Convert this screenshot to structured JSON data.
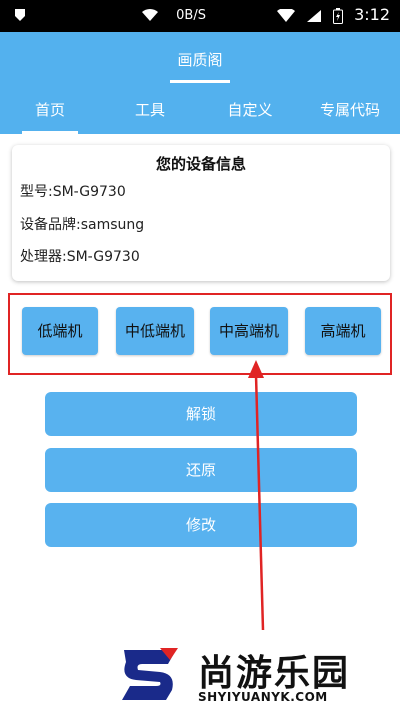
{
  "status_bar": {
    "net_speed": "0B/S",
    "time": "3:12"
  },
  "header": {
    "title": "画质阁"
  },
  "tabs": [
    {
      "label": "首页",
      "active": true
    },
    {
      "label": "工具",
      "active": false
    },
    {
      "label": "自定义",
      "active": false
    },
    {
      "label": "专属代码",
      "active": false
    }
  ],
  "device_info": {
    "title": "您的设备信息",
    "model": "型号:SM-G9730",
    "brand": "设备品牌:samsung",
    "processor": "处理器:SM-G9730"
  },
  "tiers": [
    "低端机",
    "中低端机",
    "中高端机",
    "高端机"
  ],
  "actions": {
    "unlock": "解锁",
    "restore": "还原",
    "modify": "修改"
  },
  "watermark": {
    "cn": "尚游乐园",
    "en": "SHYIYUANYK.COM"
  },
  "colors": {
    "accent": "#53b1ee",
    "highlight": "#e02424"
  }
}
